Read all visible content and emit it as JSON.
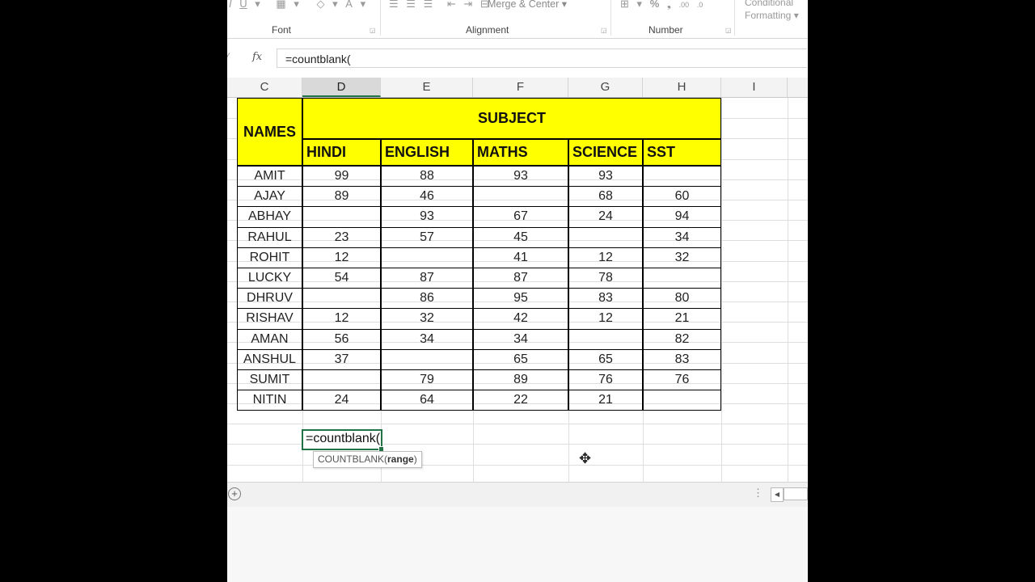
{
  "ribbon": {
    "groups": [
      {
        "label": "Font"
      },
      {
        "label": "Alignment"
      },
      {
        "label": "Number"
      }
    ],
    "merge_center": "Merge & Center",
    "percent": "%",
    "conditional_formatting": [
      "Conditional",
      "Formatting"
    ],
    "font_tools": [
      "I",
      "U"
    ],
    "font_color_letter": "A"
  },
  "formula_bar": {
    "fx": "fx",
    "value": "=countblank("
  },
  "columns": [
    "C",
    "D",
    "E",
    "F",
    "G",
    "H",
    "I"
  ],
  "selected_column": "D",
  "table": {
    "names_header": "NAMES",
    "subject_header": "SUBJECT",
    "subjects": [
      "HINDI",
      "ENGLISH",
      "MATHS",
      "SCIENCE",
      "SST"
    ],
    "rows": [
      {
        "name": "AMIT",
        "scores": [
          "99",
          "88",
          "93",
          "93",
          ""
        ]
      },
      {
        "name": "AJAY",
        "scores": [
          "89",
          "46",
          "",
          "68",
          "60"
        ]
      },
      {
        "name": "ABHAY",
        "scores": [
          "",
          "93",
          "67",
          "24",
          "94"
        ]
      },
      {
        "name": "RAHUL",
        "scores": [
          "23",
          "57",
          "45",
          "",
          "34"
        ]
      },
      {
        "name": "ROHIT",
        "scores": [
          "12",
          "",
          "41",
          "12",
          "32"
        ]
      },
      {
        "name": "LUCKY",
        "scores": [
          "54",
          "87",
          "87",
          "78",
          ""
        ]
      },
      {
        "name": "DHRUV",
        "scores": [
          "",
          "86",
          "95",
          "83",
          "80"
        ]
      },
      {
        "name": "RISHAV",
        "scores": [
          "12",
          "32",
          "42",
          "12",
          "21"
        ]
      },
      {
        "name": "AMAN",
        "scores": [
          "56",
          "34",
          "34",
          "",
          "82"
        ]
      },
      {
        "name": "ANSHUL",
        "scores": [
          "37",
          "",
          "65",
          "65",
          "83"
        ]
      },
      {
        "name": "SUMIT",
        "scores": [
          "",
          "79",
          "89",
          "76",
          "76"
        ]
      },
      {
        "name": "NITIN",
        "scores": [
          "24",
          "64",
          "22",
          "21",
          ""
        ]
      }
    ]
  },
  "active_cell": {
    "value": "=countblank(",
    "tooltip_fn": "COUNTBLANK(",
    "tooltip_arg": "range",
    "tooltip_end": ")"
  },
  "colors": {
    "header_fill": "#ffff00",
    "selection": "#217346"
  },
  "icons": [
    "italic-icon",
    "underline-icon",
    "borders-icon",
    "fill-color-icon",
    "font-color-icon",
    "align-left-icon",
    "align-center-icon",
    "align-right-icon",
    "decrease-indent-icon",
    "increase-indent-icon",
    "merge-icon",
    "currency-icon",
    "percent-icon",
    "increase-decimal-icon",
    "decrease-decimal-icon",
    "fx-icon",
    "add-sheet-icon",
    "move-cursor-icon"
  ]
}
